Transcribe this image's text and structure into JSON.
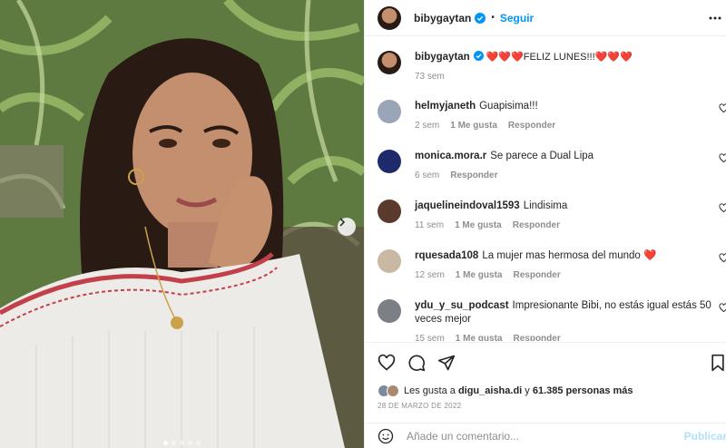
{
  "post": {
    "author": "bibygaytan",
    "follow_label": "Seguir",
    "separator": "•",
    "caption_text": "❤️❤️❤️FELIZ LUNES!!!❤️❤️❤️",
    "caption_time": "73 sem"
  },
  "comments": [
    {
      "user": "helmyjaneth",
      "text": "Guapisima!!!",
      "time": "2 sem",
      "likes": "1 Me gusta",
      "reply": "Responder",
      "avatar_color": "#9aa6b8"
    },
    {
      "user": "monica.mora.r",
      "text": "Se parece a Dual Lipa",
      "time": "6 sem",
      "likes": "",
      "reply": "Responder",
      "avatar_color": "#1f2a6b"
    },
    {
      "user": "jaquelineindoval1593",
      "text": "Lindisima",
      "time": "11 sem",
      "likes": "1 Me gusta",
      "reply": "Responder",
      "avatar_color": "#5a3a2c"
    },
    {
      "user": "rquesada108",
      "text": "La mujer mas hermosa del mundo ❤️",
      "time": "12 sem",
      "likes": "1 Me gusta",
      "reply": "Responder",
      "avatar_color": "#c9b9a4"
    },
    {
      "user": "ydu_y_su_podcast",
      "text": "Impresionante Bibi, no estás igual estás 50 veces mejor",
      "time": "15 sem",
      "likes": "1 Me gusta",
      "reply": "Responder",
      "avatar_color": "#7c7f86"
    }
  ],
  "likes_line": {
    "prefix": "Les gusta a",
    "user": "digu_aisha.di",
    "connector": "y",
    "count_text": "61.385 personas más"
  },
  "date": "28 DE MARZO DE 2022",
  "add_comment": {
    "placeholder": "Añade un comentario...",
    "publish_label": "Publicar"
  },
  "colors": {
    "accent": "#0095f6",
    "heart": "#ed4956",
    "muted": "#8e8e8e"
  },
  "icons": [
    "chevron-right-icon",
    "more-icon",
    "verified-icon",
    "heart-icon",
    "comment-icon",
    "share-icon",
    "bookmark-icon",
    "emoji-icon"
  ]
}
